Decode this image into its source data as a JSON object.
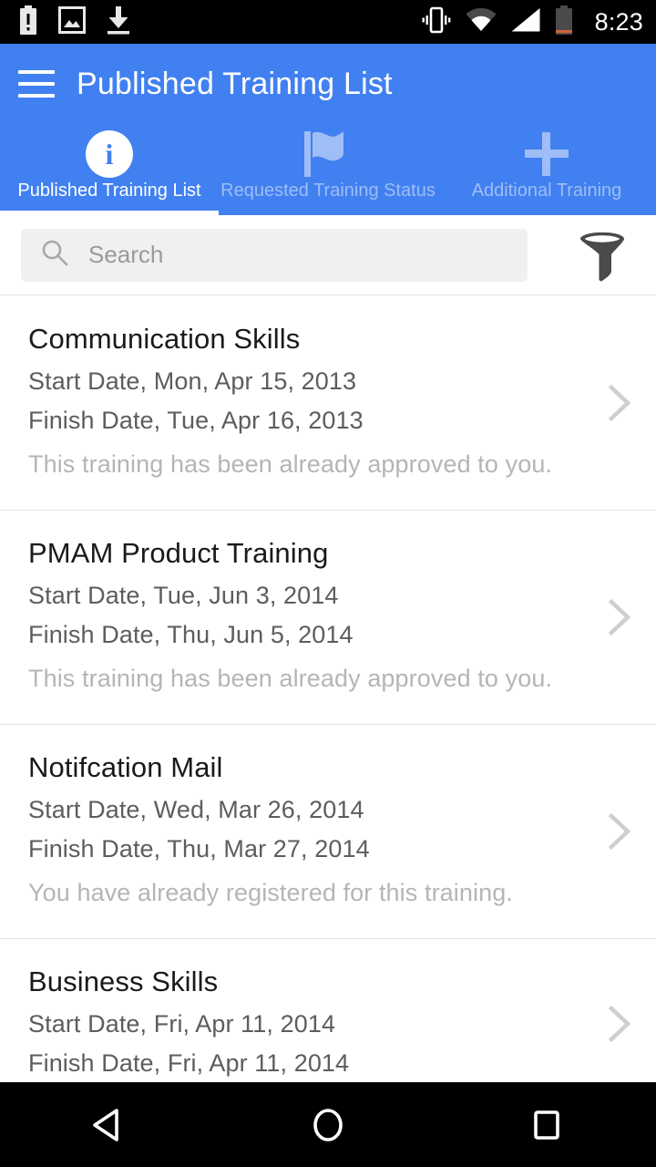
{
  "status_bar": {
    "time": "8:23",
    "left_icons": [
      "battery-alert-icon",
      "image-icon",
      "download-icon"
    ],
    "right_icons": [
      "vibrate-icon",
      "wifi-icon",
      "signal-icon",
      "battery-icon"
    ]
  },
  "app_bar": {
    "menu_icon": "hamburger-menu-icon",
    "title": "Published Training List",
    "background_color": "#4180f0"
  },
  "tabs": [
    {
      "label": "Published Training List",
      "icon": "info-icon",
      "active": true
    },
    {
      "label": "Requested Training Status",
      "icon": "flag-icon",
      "active": false
    },
    {
      "label": "Additional Training",
      "icon": "plus-icon",
      "active": false
    }
  ],
  "search": {
    "placeholder": "Search",
    "value": "",
    "icon": "search-icon",
    "filter_icon": "filter-funnel-icon"
  },
  "list": {
    "labels": {
      "start": "Start Date",
      "finish": "Finish Date"
    },
    "items": [
      {
        "title": "Communication Skills",
        "start_date": "Start Date, Mon, Apr 15, 2013",
        "finish_date": "Finish Date, Tue, Apr 16, 2013",
        "status": "This training has been already approved to you."
      },
      {
        "title": "PMAM Product Training",
        "start_date": "Start Date, Tue, Jun 3, 2014",
        "finish_date": "Finish Date, Thu, Jun 5, 2014",
        "status": "This training has been already approved to you."
      },
      {
        "title": "Notifcation Mail",
        "start_date": "Start Date, Wed, Mar 26, 2014",
        "finish_date": "Finish Date, Thu, Mar 27, 2014",
        "status": "You have already registered for this training."
      },
      {
        "title": "Business Skills",
        "start_date": "Start Date, Fri, Apr 11, 2014",
        "finish_date": "Finish Date, Fri, Apr 11, 2014",
        "status": ""
      }
    ]
  },
  "nav_bar": {
    "back": "back-icon",
    "home": "home-icon",
    "recents": "recents-icon"
  },
  "colors": {
    "accent": "#4180f0",
    "tab_inactive": "#9fbdf6",
    "title_text": "#1a1a1a",
    "date_text": "#5d5d5d",
    "status_text": "#b5b5b5",
    "search_bg": "#f0f0f0"
  }
}
